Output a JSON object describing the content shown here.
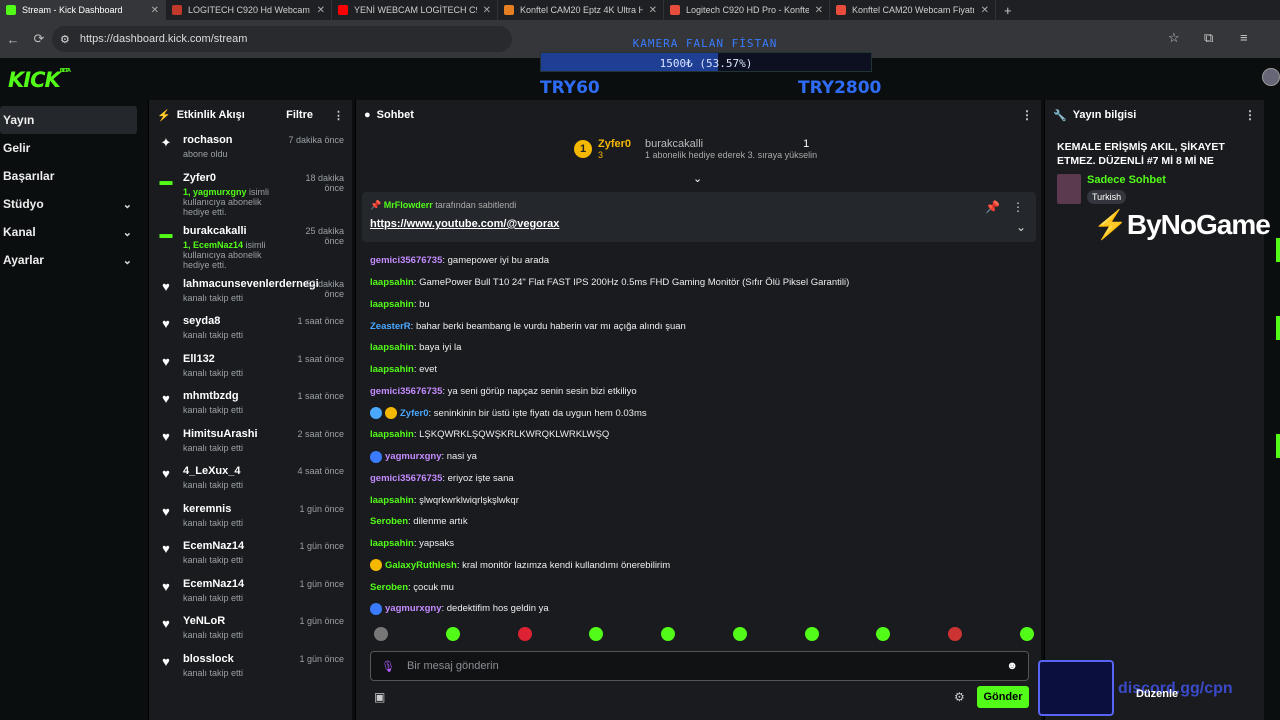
{
  "tabs": [
    {
      "title": "Stream - Kick Dashboard",
      "color": "#53fc18",
      "active": true
    },
    {
      "title": "LOGITECH C920 Hd Webcam 9",
      "color": "#c0392b"
    },
    {
      "title": "YENİ WEBCAM LOGİTECH C920",
      "color": "#ff0000"
    },
    {
      "title": "Konftel CAM20 Eptz 4K Ultra H",
      "color": "#e67e22"
    },
    {
      "title": "Logitech C920 HD Pro - Konftel",
      "color": "#e74c3c"
    },
    {
      "title": "Konftel CAM20 Webcam Fiyatı",
      "color": "#e74c3c"
    }
  ],
  "address": "https://dashboard.kick.com/stream",
  "logo": "KICK",
  "logo_sup": "BETA",
  "goal": {
    "title": "KAMERA FALAN FİSTAN",
    "progress_text": "1500₺ (53.57%)",
    "progress": 0.5357,
    "min": "TRY60",
    "max": "TRY2800"
  },
  "sidebar": [
    "Yayın",
    "Gelir",
    "Başarılar",
    "Stüdyo",
    "Kanal",
    "Ayarlar"
  ],
  "activity": {
    "title": "Etkinlik Akışı",
    "filter": "Filtre",
    "items": [
      {
        "icon": "sparkle",
        "user": "rochason",
        "desc": "abone oldu",
        "time": "7 dakika önce"
      },
      {
        "icon": "gift",
        "user": "Zyfer0",
        "desc_b": "1, yagmurxgny",
        "desc": " isimli kullanıcıya abonelik hediye etti.",
        "time": "18 dakika önce"
      },
      {
        "icon": "gift",
        "user": "burakcakalli",
        "desc_b": "1, EcemNaz14",
        "desc": " isimli kullanıcıya abonelik hediye etti.",
        "time": "25 dakika önce"
      },
      {
        "icon": "heart",
        "user": "lahmacunsevenlerdernegi",
        "desc": "kanalı takip etti",
        "time": "52 dakika önce"
      },
      {
        "icon": "heart",
        "user": "seyda8",
        "desc": "kanalı takip etti",
        "time": "1 saat önce"
      },
      {
        "icon": "heart",
        "user": "Ell132",
        "desc": "kanalı takip etti",
        "time": "1 saat önce"
      },
      {
        "icon": "heart",
        "user": "mhmtbzdg",
        "desc": "kanalı takip etti",
        "time": "1 saat önce"
      },
      {
        "icon": "heart",
        "user": "HimitsuArashi",
        "desc": "kanalı takip etti",
        "time": "2 saat önce"
      },
      {
        "icon": "heart",
        "user": "4_LeXux_4",
        "desc": "kanalı takip etti",
        "time": "4 saat önce"
      },
      {
        "icon": "heart",
        "user": "keremnis",
        "desc": "kanalı takip etti",
        "time": "1 gün önce"
      },
      {
        "icon": "heart",
        "user": "EcemNaz14",
        "desc": "kanalı takip etti",
        "time": "1 gün önce"
      },
      {
        "icon": "heart",
        "user": "EcemNaz14",
        "desc": "kanalı takip etti",
        "time": "1 gün önce"
      },
      {
        "icon": "heart",
        "user": "YeNLoR",
        "desc": "kanalı takip etti",
        "time": "1 gün önce"
      },
      {
        "icon": "heart",
        "user": "blosslock",
        "desc": "kanalı takip etti",
        "time": "1 gün önce"
      }
    ]
  },
  "chat": {
    "title": "Sohbet",
    "top_gifter": {
      "user": "Zyfer0",
      "count": "3",
      "second": "burakcakalli",
      "second_count": "1",
      "note": "1 abonelik hediye ederek 3. sıraya yükselin"
    },
    "pinned": {
      "by": "MrFlowderr",
      "by_suffix": " tarafından sabitlendi",
      "link": "https://www.youtube.com/@vegorax"
    },
    "messages": [
      {
        "user": "gemici35676735",
        "color": "#c58cff",
        "text": ": gamepower iyi bu arada"
      },
      {
        "user": "laapsahin",
        "color": "#53fc18",
        "text": ": GamePower Bull T10 24\" Flat FAST IPS 200Hz 0.5ms FHD Gaming Monitör (Sıfır Ölü Piksel Garantili)"
      },
      {
        "user": "laapsahin",
        "color": "#53fc18",
        "text": ": bu"
      },
      {
        "user": "ZeasterR",
        "color": "#4aa8ff",
        "text": ": bahar berki beambang le vurdu haberin var mı açığa alındı şuan"
      },
      {
        "user": "laapsahin",
        "color": "#53fc18",
        "text": ": baya iyi la"
      },
      {
        "user": "laapsahin",
        "color": "#53fc18",
        "text": ": evet"
      },
      {
        "user": "gemici35676735",
        "color": "#c58cff",
        "text": ": ya seni görüp napçaz senin sesin bizi etkiliyo"
      },
      {
        "user": "Zyfer0",
        "color": "#4aa8ff",
        "text": ": seninkinin bir üstü işte fiyatı da uygun hem 0.03ms",
        "badges": [
          "#4aa8ff",
          "#f5b800"
        ]
      },
      {
        "user": "laapsahin",
        "color": "#53fc18",
        "text": ": LŞKQWRKLŞQWŞKRLKWRQKLWRKLWŞQ"
      },
      {
        "user": "yagmurxgny",
        "color": "#c58cff",
        "text": ": nasi ya",
        "badges": [
          "#3a7bff"
        ]
      },
      {
        "user": "gemici35676735",
        "color": "#c58cff",
        "text": ": eriyoz işte sana"
      },
      {
        "user": "laapsahin",
        "color": "#53fc18",
        "text": ": şlwqrkwrklwiqrlşkşlwkqr"
      },
      {
        "user": "Seroben",
        "color": "#53fc18",
        "text": ": dilenme artık"
      },
      {
        "user": "laapsahin",
        "color": "#53fc18",
        "text": ": yapsaks"
      },
      {
        "user": "GalaxyRuthlesh",
        "color": "#53fc18",
        "text": ": kral monitör lazımza kendi kullandımı önerebilirim",
        "badges": [
          "#f5b800"
        ]
      },
      {
        "user": "Seroben",
        "color": "#53fc18",
        "text": ": çocuk mu"
      },
      {
        "user": "yagmurxgny",
        "color": "#c58cff",
        "text": ": dedektifim hos geldin ya",
        "badges": [
          "#3a7bff"
        ]
      }
    ],
    "placeholder": "Bir mesaj gönderin",
    "send": "Gönder"
  },
  "info": {
    "title": "Yayın bilgisi",
    "stream_title": "KEMALE ERİŞMİŞ AKIL, ŞİKAYET ETMEZ. DÜZENLİ #7 Mİ 8 Mİ NE",
    "category": "Sadece Sohbet",
    "tag": "Turkish",
    "sponsor": "ByNoGame",
    "edit": "Düzenle"
  },
  "discord_text": "discord.gg/cpn"
}
